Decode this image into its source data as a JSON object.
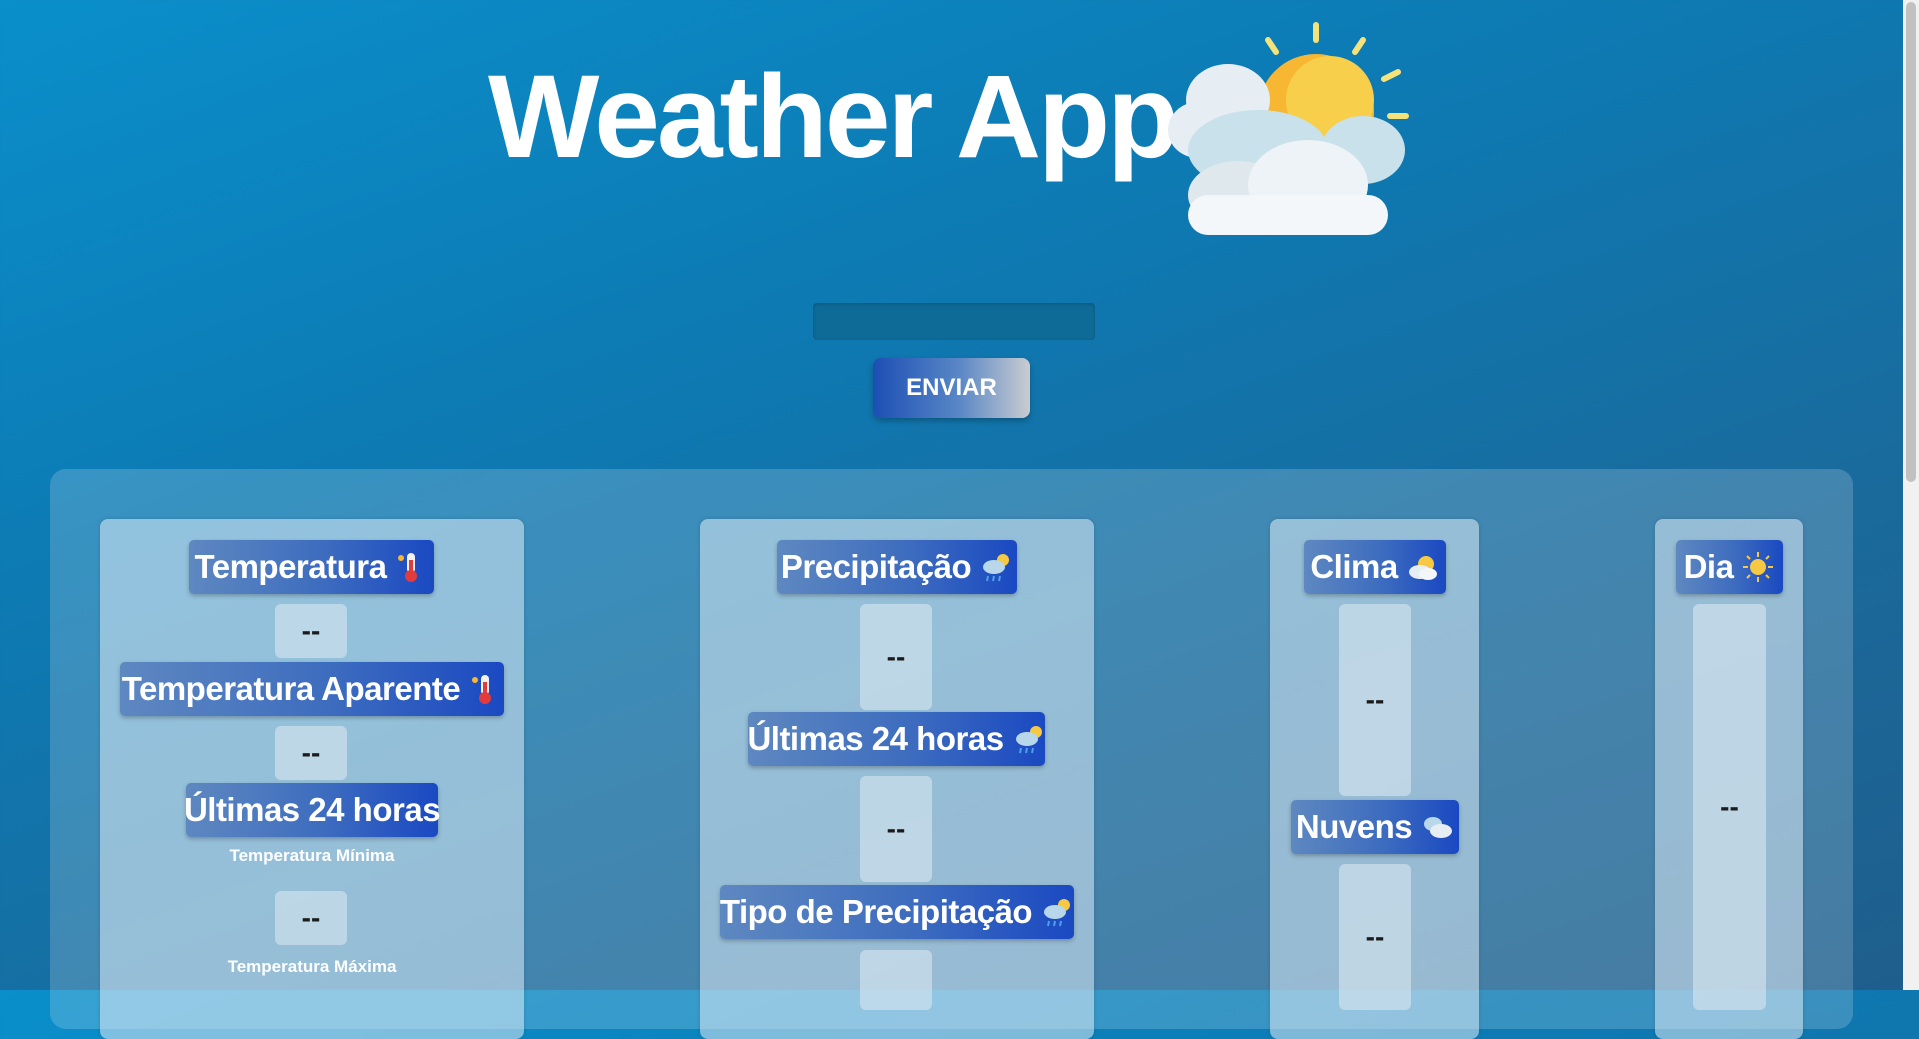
{
  "header": {
    "title": "Weather App"
  },
  "search": {
    "placeholder": "",
    "button_label": "ENVIAR"
  },
  "temperature": {
    "label": "Temperatura",
    "value": "--",
    "apparent_label": "Temperatura Aparente",
    "apparent_value": "--",
    "last24_label": "Últimas 24 horas",
    "min_label": "Temperatura Mínima",
    "min_value": "--",
    "max_label": "Temperatura Máxima"
  },
  "precipitation": {
    "label": "Precipitação",
    "value": "--",
    "last24_label": "Últimas 24 horas",
    "last24_value": "--",
    "type_label": "Tipo de Precipitação"
  },
  "climate": {
    "label": "Clima",
    "value": "--",
    "clouds_label": "Nuvens",
    "clouds_value": "--"
  },
  "day": {
    "label": "Dia",
    "value": "--"
  },
  "colors": {
    "accent": "#1a49c2",
    "background": "#0d7ab3"
  },
  "icons": [
    "weather-logo-icon",
    "thermometer-icon",
    "rain-cloud-icon",
    "partly-cloudy-icon",
    "clouds-icon",
    "sun-icon"
  ]
}
